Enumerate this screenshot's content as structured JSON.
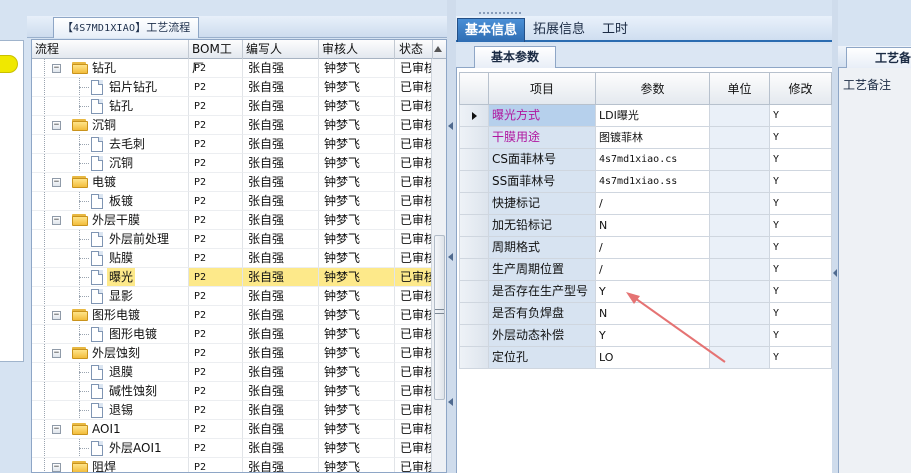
{
  "left_panel": {},
  "process_tree": {
    "title_code": "4S7MD1XIAO",
    "title_text": "工艺流程",
    "title_open": "【",
    "title_close": "】",
    "columns": [
      "流程",
      "BOM工厂",
      "编写人",
      "审核人",
      "状态"
    ],
    "rows": [
      {
        "label": "钻孔",
        "type": "folder",
        "level": 0,
        "expanded": true,
        "bom": "P2",
        "writer": "张自强",
        "reviewer": "钟梦飞",
        "status": "已审核"
      },
      {
        "label": "铝片钻孔",
        "type": "file",
        "level": 1,
        "bom": "P2",
        "writer": "张自强",
        "reviewer": "钟梦飞",
        "status": "已审核"
      },
      {
        "label": "钻孔",
        "type": "file",
        "level": 1,
        "bom": "P2",
        "writer": "张自强",
        "reviewer": "钟梦飞",
        "status": "已审核"
      },
      {
        "label": "沉铜",
        "type": "folder",
        "level": 0,
        "expanded": true,
        "bom": "P2",
        "writer": "张自强",
        "reviewer": "钟梦飞",
        "status": "已审核"
      },
      {
        "label": "去毛刺",
        "type": "file",
        "level": 1,
        "bom": "P2",
        "writer": "张自强",
        "reviewer": "钟梦飞",
        "status": "已审核"
      },
      {
        "label": "沉铜",
        "type": "file",
        "level": 1,
        "bom": "P2",
        "writer": "张自强",
        "reviewer": "钟梦飞",
        "status": "已审核"
      },
      {
        "label": "电镀",
        "type": "folder",
        "level": 0,
        "expanded": true,
        "bom": "P2",
        "writer": "张自强",
        "reviewer": "钟梦飞",
        "status": "已审核"
      },
      {
        "label": "板镀",
        "type": "file",
        "level": 1,
        "bom": "P2",
        "writer": "张自强",
        "reviewer": "钟梦飞",
        "status": "已审核"
      },
      {
        "label": "外层干膜",
        "type": "folder",
        "level": 0,
        "expanded": true,
        "bom": "P2",
        "writer": "张自强",
        "reviewer": "钟梦飞",
        "status": "已审核"
      },
      {
        "label": "外层前处理",
        "type": "file",
        "level": 1,
        "bom": "P2",
        "writer": "张自强",
        "reviewer": "钟梦飞",
        "status": "已审核"
      },
      {
        "label": "贴膜",
        "type": "file",
        "level": 1,
        "bom": "P2",
        "writer": "张自强",
        "reviewer": "钟梦飞",
        "status": "已审核"
      },
      {
        "label": "曝光",
        "type": "file",
        "level": 1,
        "selected": true,
        "bom": "P2",
        "writer": "张自强",
        "reviewer": "钟梦飞",
        "status": "已审核"
      },
      {
        "label": "显影",
        "type": "file",
        "level": 1,
        "bom": "P2",
        "writer": "张自强",
        "reviewer": "钟梦飞",
        "status": "已审核"
      },
      {
        "label": "图形电镀",
        "type": "folder",
        "level": 0,
        "expanded": true,
        "bom": "P2",
        "writer": "张自强",
        "reviewer": "钟梦飞",
        "status": "已审核"
      },
      {
        "label": "图形电镀",
        "type": "file",
        "level": 1,
        "bom": "P2",
        "writer": "张自强",
        "reviewer": "钟梦飞",
        "status": "已审核"
      },
      {
        "label": "外层蚀刻",
        "type": "folder",
        "level": 0,
        "expanded": true,
        "bom": "P2",
        "writer": "张自强",
        "reviewer": "钟梦飞",
        "status": "已审核"
      },
      {
        "label": "退膜",
        "type": "file",
        "level": 1,
        "bom": "P2",
        "writer": "张自强",
        "reviewer": "钟梦飞",
        "status": "已审核"
      },
      {
        "label": "碱性蚀刻",
        "type": "file",
        "level": 1,
        "bom": "P2",
        "writer": "张自强",
        "reviewer": "钟梦飞",
        "status": "已审核"
      },
      {
        "label": "退锡",
        "type": "file",
        "level": 1,
        "bom": "P2",
        "writer": "张自强",
        "reviewer": "钟梦飞",
        "status": "已审核"
      },
      {
        "label": "AOI1",
        "type": "folder",
        "level": 0,
        "expanded": true,
        "bom": "P2",
        "writer": "张自强",
        "reviewer": "钟梦飞",
        "status": "已审核"
      },
      {
        "label": "外层AOI1",
        "type": "file",
        "level": 1,
        "bom": "P2",
        "writer": "张自强",
        "reviewer": "钟梦飞",
        "status": "已审核"
      },
      {
        "label": "阻焊",
        "type": "folder",
        "level": 0,
        "expanded": true,
        "bom": "P2",
        "writer": "张自强",
        "reviewer": "钟梦飞",
        "status": "已审核"
      }
    ]
  },
  "detail": {
    "tabs": [
      "基本信息",
      "拓展信息",
      "工时"
    ],
    "active_tab": 0,
    "subtab": "基本参数",
    "columns": [
      "项目",
      "参数",
      "单位",
      "修改"
    ],
    "rows": [
      {
        "item": "曝光方式",
        "value": "LDI曝光",
        "unit": "",
        "modify": "Y",
        "highlight": true,
        "current": true
      },
      {
        "item": "干膜用途",
        "value": "图镀菲林",
        "unit": "",
        "modify": "Y",
        "highlight": true
      },
      {
        "item": "CS面菲林号",
        "value": "4s7md1xiao.cs",
        "unit": "",
        "modify": "Y",
        "mono": true
      },
      {
        "item": "SS面菲林号",
        "value": "4s7md1xiao.ss",
        "unit": "",
        "modify": "Y",
        "mono": true
      },
      {
        "item": "快捷标记",
        "value": "/",
        "unit": "",
        "modify": "Y"
      },
      {
        "item": "加无铅标记",
        "value": "N",
        "unit": "",
        "modify": "Y"
      },
      {
        "item": "周期格式",
        "value": "/",
        "unit": "",
        "modify": "Y"
      },
      {
        "item": "生产周期位置",
        "value": "/",
        "unit": "",
        "modify": "Y"
      },
      {
        "item": "是否存在生产型号",
        "value": "Y",
        "unit": "",
        "modify": "Y"
      },
      {
        "item": "是否有负焊盘",
        "value": "N",
        "unit": "",
        "modify": "Y"
      },
      {
        "item": "外层动态补偿",
        "value": "Y",
        "unit": "",
        "modify": "Y"
      },
      {
        "item": "定位孔",
        "value": "LO",
        "unit": "",
        "modify": "Y"
      }
    ]
  },
  "process_notes": {
    "tab_label": "工艺备",
    "label": "工艺备注"
  },
  "colors": {
    "accent_tab": "#2e6db3",
    "selection": "#fde98a",
    "highlight_text": "#b0169f",
    "annotation_arrow": "#e57373"
  }
}
